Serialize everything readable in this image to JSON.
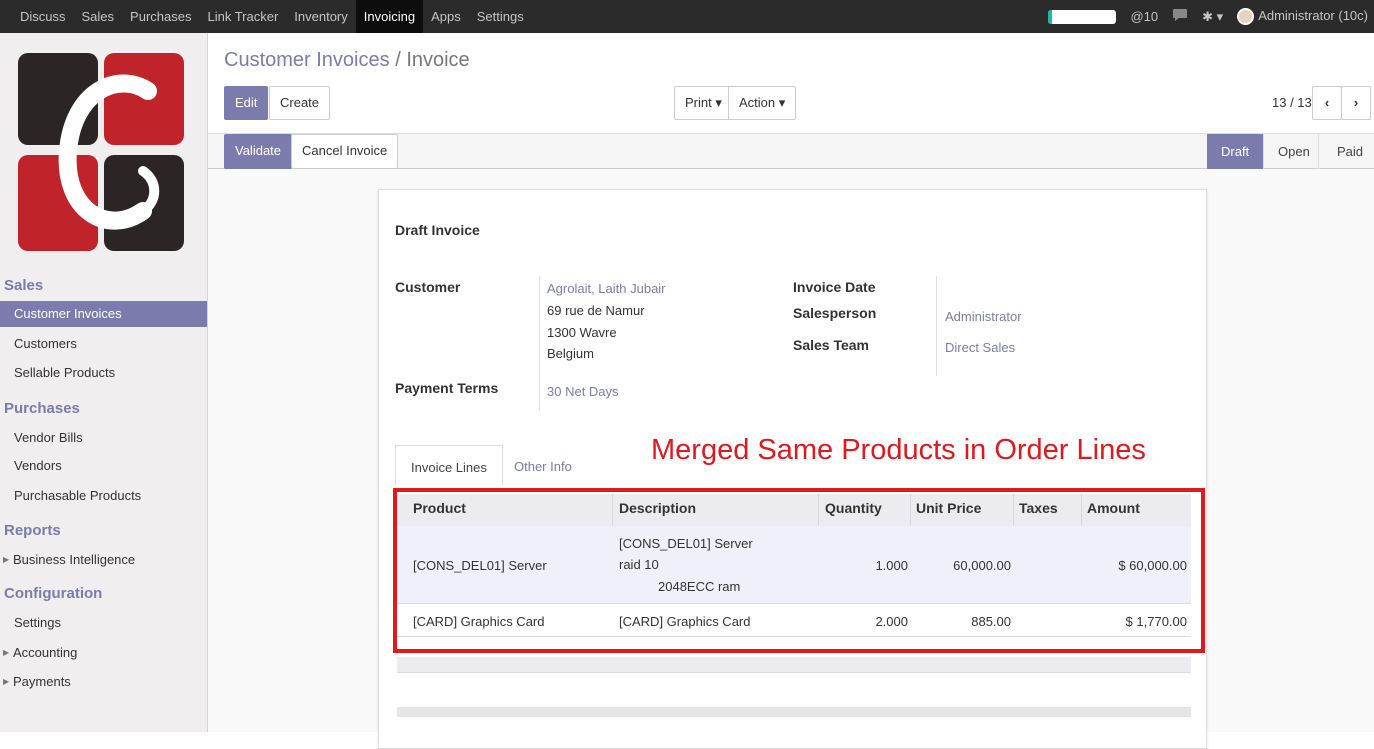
{
  "topbar": {
    "menu": [
      "Discuss",
      "Sales",
      "Purchases",
      "Link Tracker",
      "Inventory",
      "Invoicing",
      "Apps",
      "Settings"
    ],
    "active": "Invoicing",
    "mentions": "@10",
    "user": "Administrator (10c)"
  },
  "sidebar": {
    "sections": [
      {
        "title": "Sales",
        "items": [
          "Customer Invoices",
          "Customers",
          "Sellable Products"
        ]
      },
      {
        "title": "Purchases",
        "items": [
          "Vendor Bills",
          "Vendors",
          "Purchasable Products"
        ]
      },
      {
        "title": "Reports",
        "items": [
          "Business Intelligence"
        ]
      },
      {
        "title": "Configuration",
        "items": [
          "Settings",
          "Accounting",
          "Payments"
        ]
      }
    ],
    "active": "Customer Invoices"
  },
  "breadcrumb": {
    "parent": "Customer Invoices",
    "sep": "/",
    "current": "Invoice"
  },
  "buttons": {
    "edit": "Edit",
    "create": "Create",
    "print": "Print",
    "action": "Action",
    "pager": "13 / 13",
    "validate": "Validate",
    "cancel": "Cancel Invoice"
  },
  "status": {
    "stages": [
      "Draft",
      "Open",
      "Paid"
    ],
    "active": "Draft"
  },
  "form": {
    "title": "Draft Invoice",
    "customer_label": "Customer",
    "customer": {
      "name": "Agrolait, Laith Jubair",
      "street": "69 rue de Namur",
      "city": "1300 Wavre",
      "country": "Belgium"
    },
    "payment_terms_label": "Payment Terms",
    "payment_terms": "30 Net Days",
    "invoice_date_label": "Invoice Date",
    "salesperson_label": "Salesperson",
    "salesperson": "Administrator",
    "sales_team_label": "Sales Team",
    "sales_team": "Direct Sales"
  },
  "tabs": [
    "Invoice Lines",
    "Other Info"
  ],
  "annotation": "Merged Same Products in Order Lines",
  "table": {
    "headers": [
      "Product",
      "Description",
      "Quantity",
      "Unit Price",
      "Taxes",
      "Amount"
    ],
    "rows": [
      {
        "product": "[CONS_DEL01] Server",
        "desc1": "[CONS_DEL01] Server",
        "desc2": "raid 10",
        "desc3": "2048ECC ram",
        "qty": "1.000",
        "price": "60,000.00",
        "taxes": "",
        "amount": "$ 60,000.00"
      },
      {
        "product": "[CARD] Graphics Card",
        "desc1": "[CARD] Graphics Card",
        "qty": "2.000",
        "price": "885.00",
        "taxes": "",
        "amount": "$ 1,770.00"
      }
    ]
  }
}
